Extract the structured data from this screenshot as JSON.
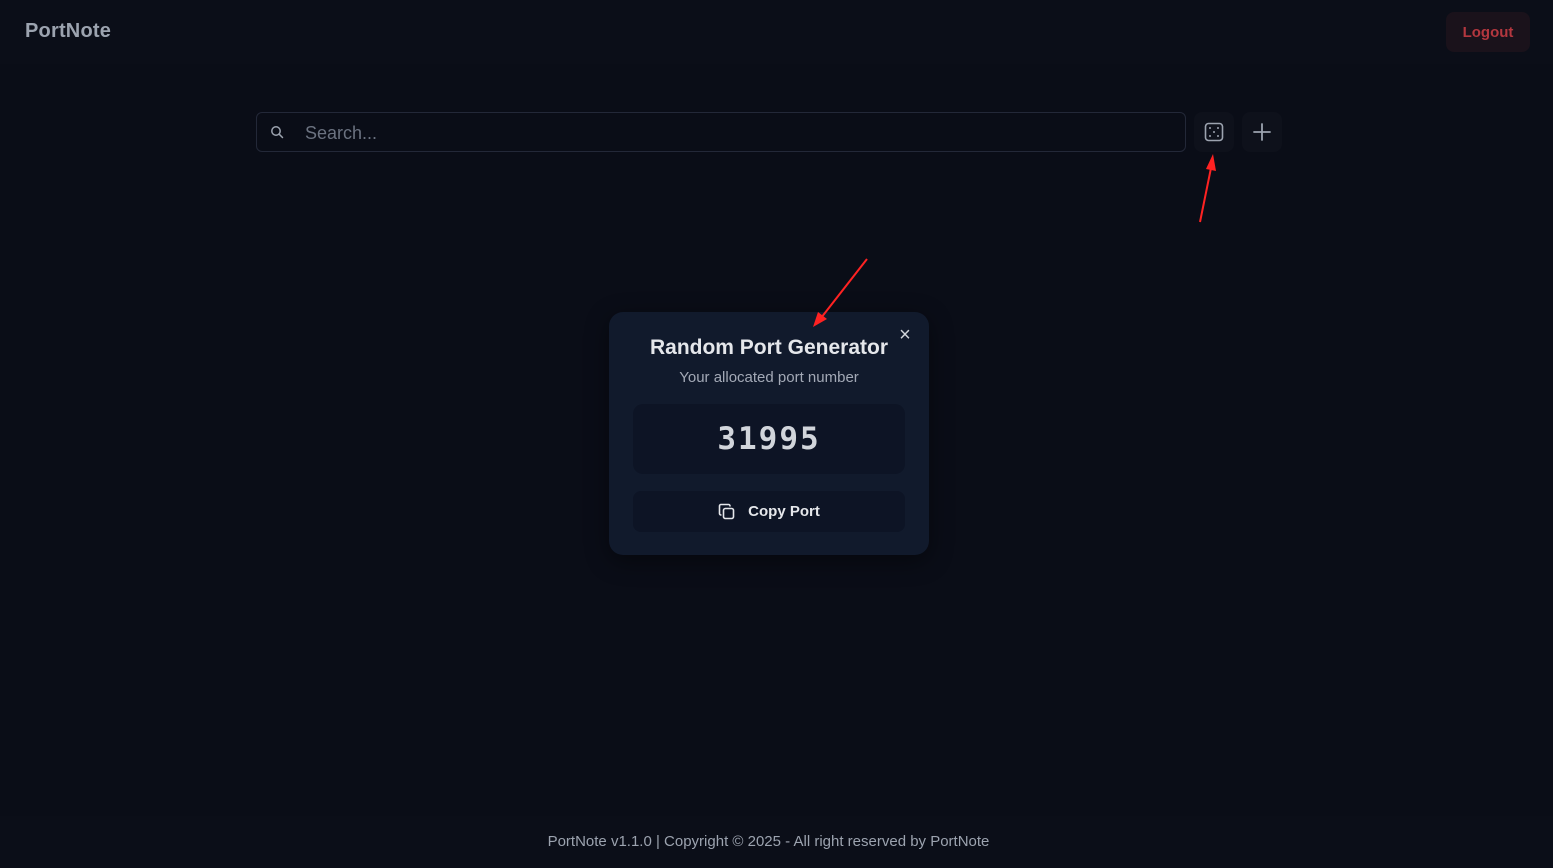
{
  "app": {
    "brand": "PortNote",
    "logout_label": "Logout"
  },
  "search": {
    "placeholder": "Search...",
    "value": "",
    "search_icon": "search-icon"
  },
  "toolbar": {
    "dice_icon": "dice-icon",
    "add_icon": "plus-icon"
  },
  "modal": {
    "title": "Random Port Generator",
    "subtitle": "Your allocated port number",
    "port": "31995",
    "copy_label": "Copy Port",
    "close_glyph": "×"
  },
  "footer": {
    "text": "PortNote v1.1.0 | Copyright © 2025 - All right reserved by PortNote"
  },
  "colors": {
    "background": "#0a0d17",
    "modal": "#111a2c",
    "logout_text": "#b4373f",
    "annotation": "#ff2222"
  }
}
